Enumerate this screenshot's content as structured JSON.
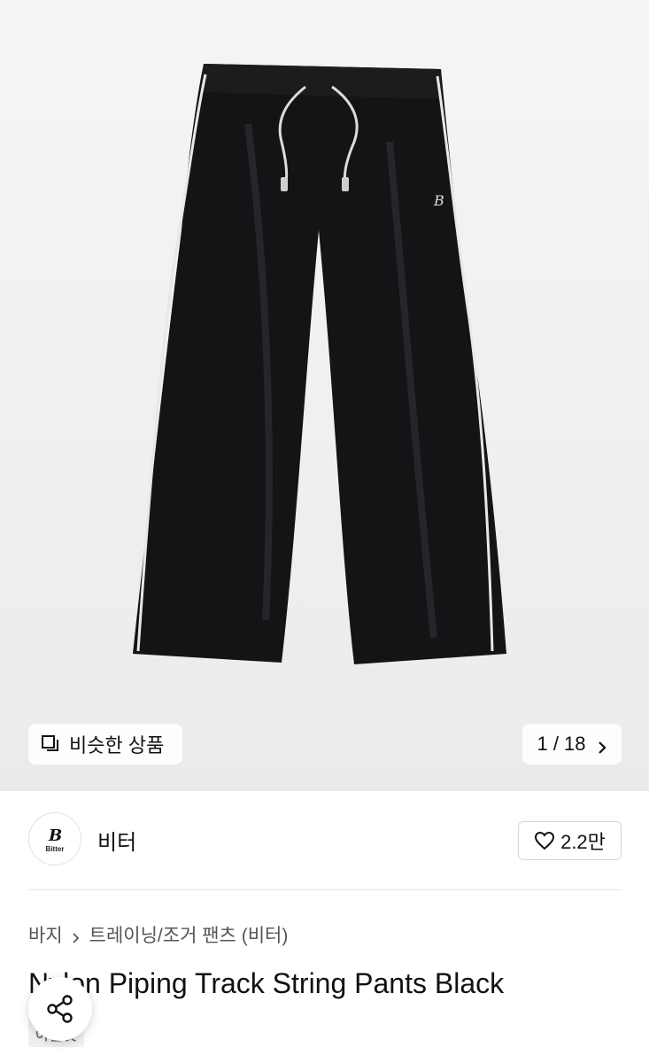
{
  "hero": {
    "similar_label": "비슷한 상품",
    "counter": "1 / 18",
    "icons": {
      "similar": "copy-icon",
      "next": "chevron-right-icon"
    }
  },
  "brand": {
    "logo_text": "Bitter",
    "name": "비터",
    "likes": "2.2만",
    "icons": {
      "like": "heart-icon"
    }
  },
  "breadcrumb": {
    "items": [
      "바지",
      "트레이닝/조거 팬츠 (비터)"
    ]
  },
  "product": {
    "title": "Nylon Piping Track String Pants Black",
    "tag": "아울렛"
  },
  "share": {
    "icon": "share-icon"
  },
  "colors": {
    "hero_bg": "#efefef",
    "pants": "#141416",
    "piping": "#e8e8e8"
  }
}
